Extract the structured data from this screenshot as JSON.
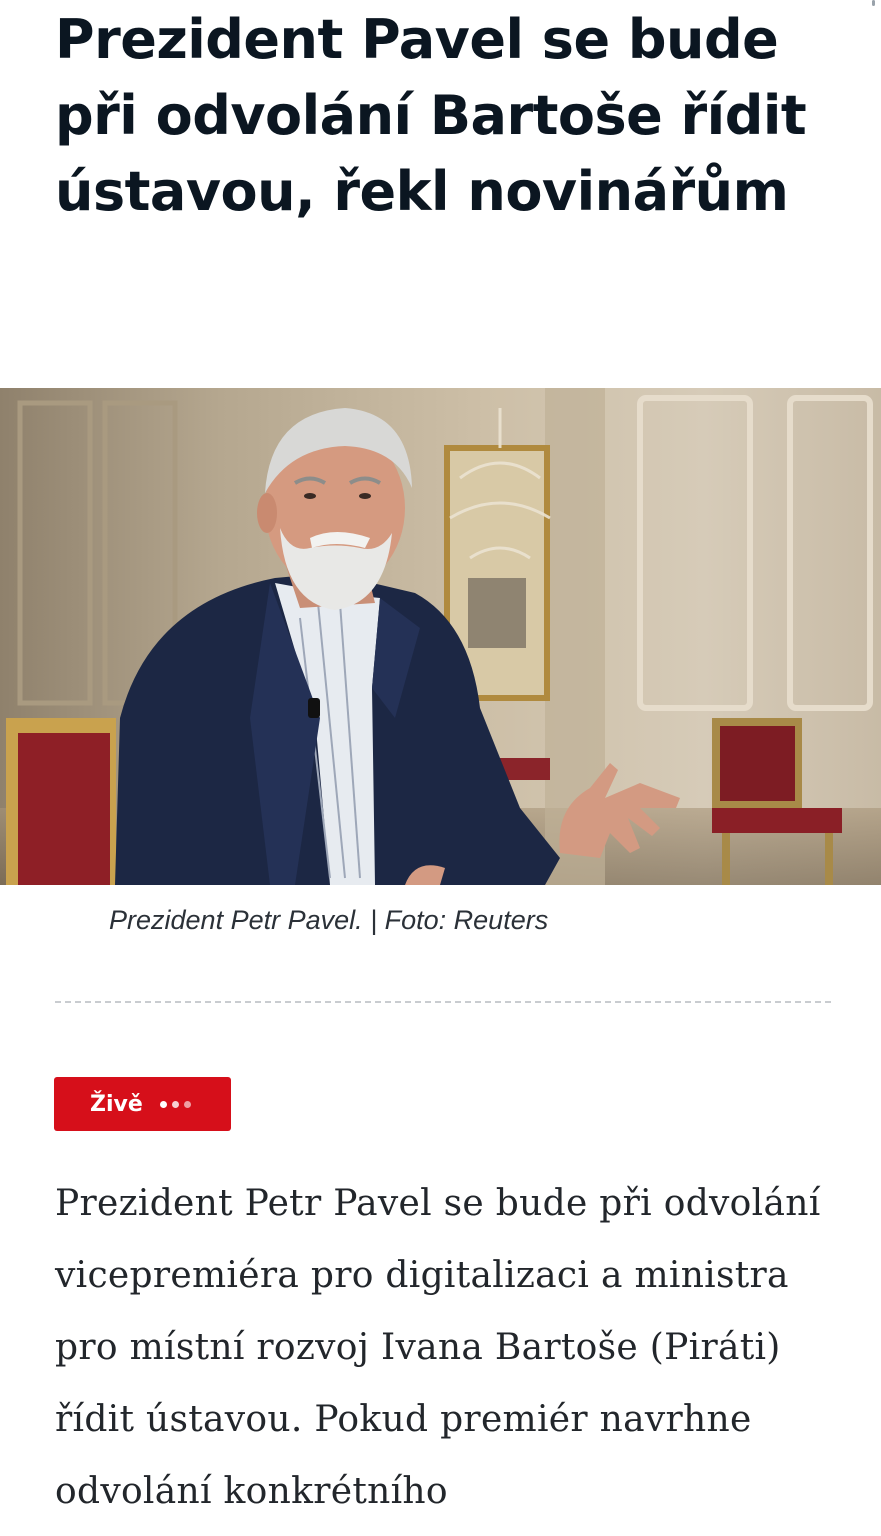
{
  "article": {
    "headline": "Prezident Pavel se bude při odvolání Bartoše řídit ústavou, řekl novinářům",
    "photo_caption": "Prezident Petr Pavel. | Foto: Reuters",
    "live_label": "Živě",
    "body_text": "Prezident Petr Pavel se bude při odvolání vicepremiéra pro digitalizaci a ministra pro místní rozvoj Ivana Bartoše (Piráti) řídit ústavou. Pokud premiér navrhne odvolání konkrétního"
  },
  "colors": {
    "live_badge": "#d60f1a",
    "headline_text": "#0b1621",
    "body_text": "#22262b",
    "divider": "#c9ccd0"
  },
  "icons": {
    "live_indicator": "three-dots-icon"
  }
}
